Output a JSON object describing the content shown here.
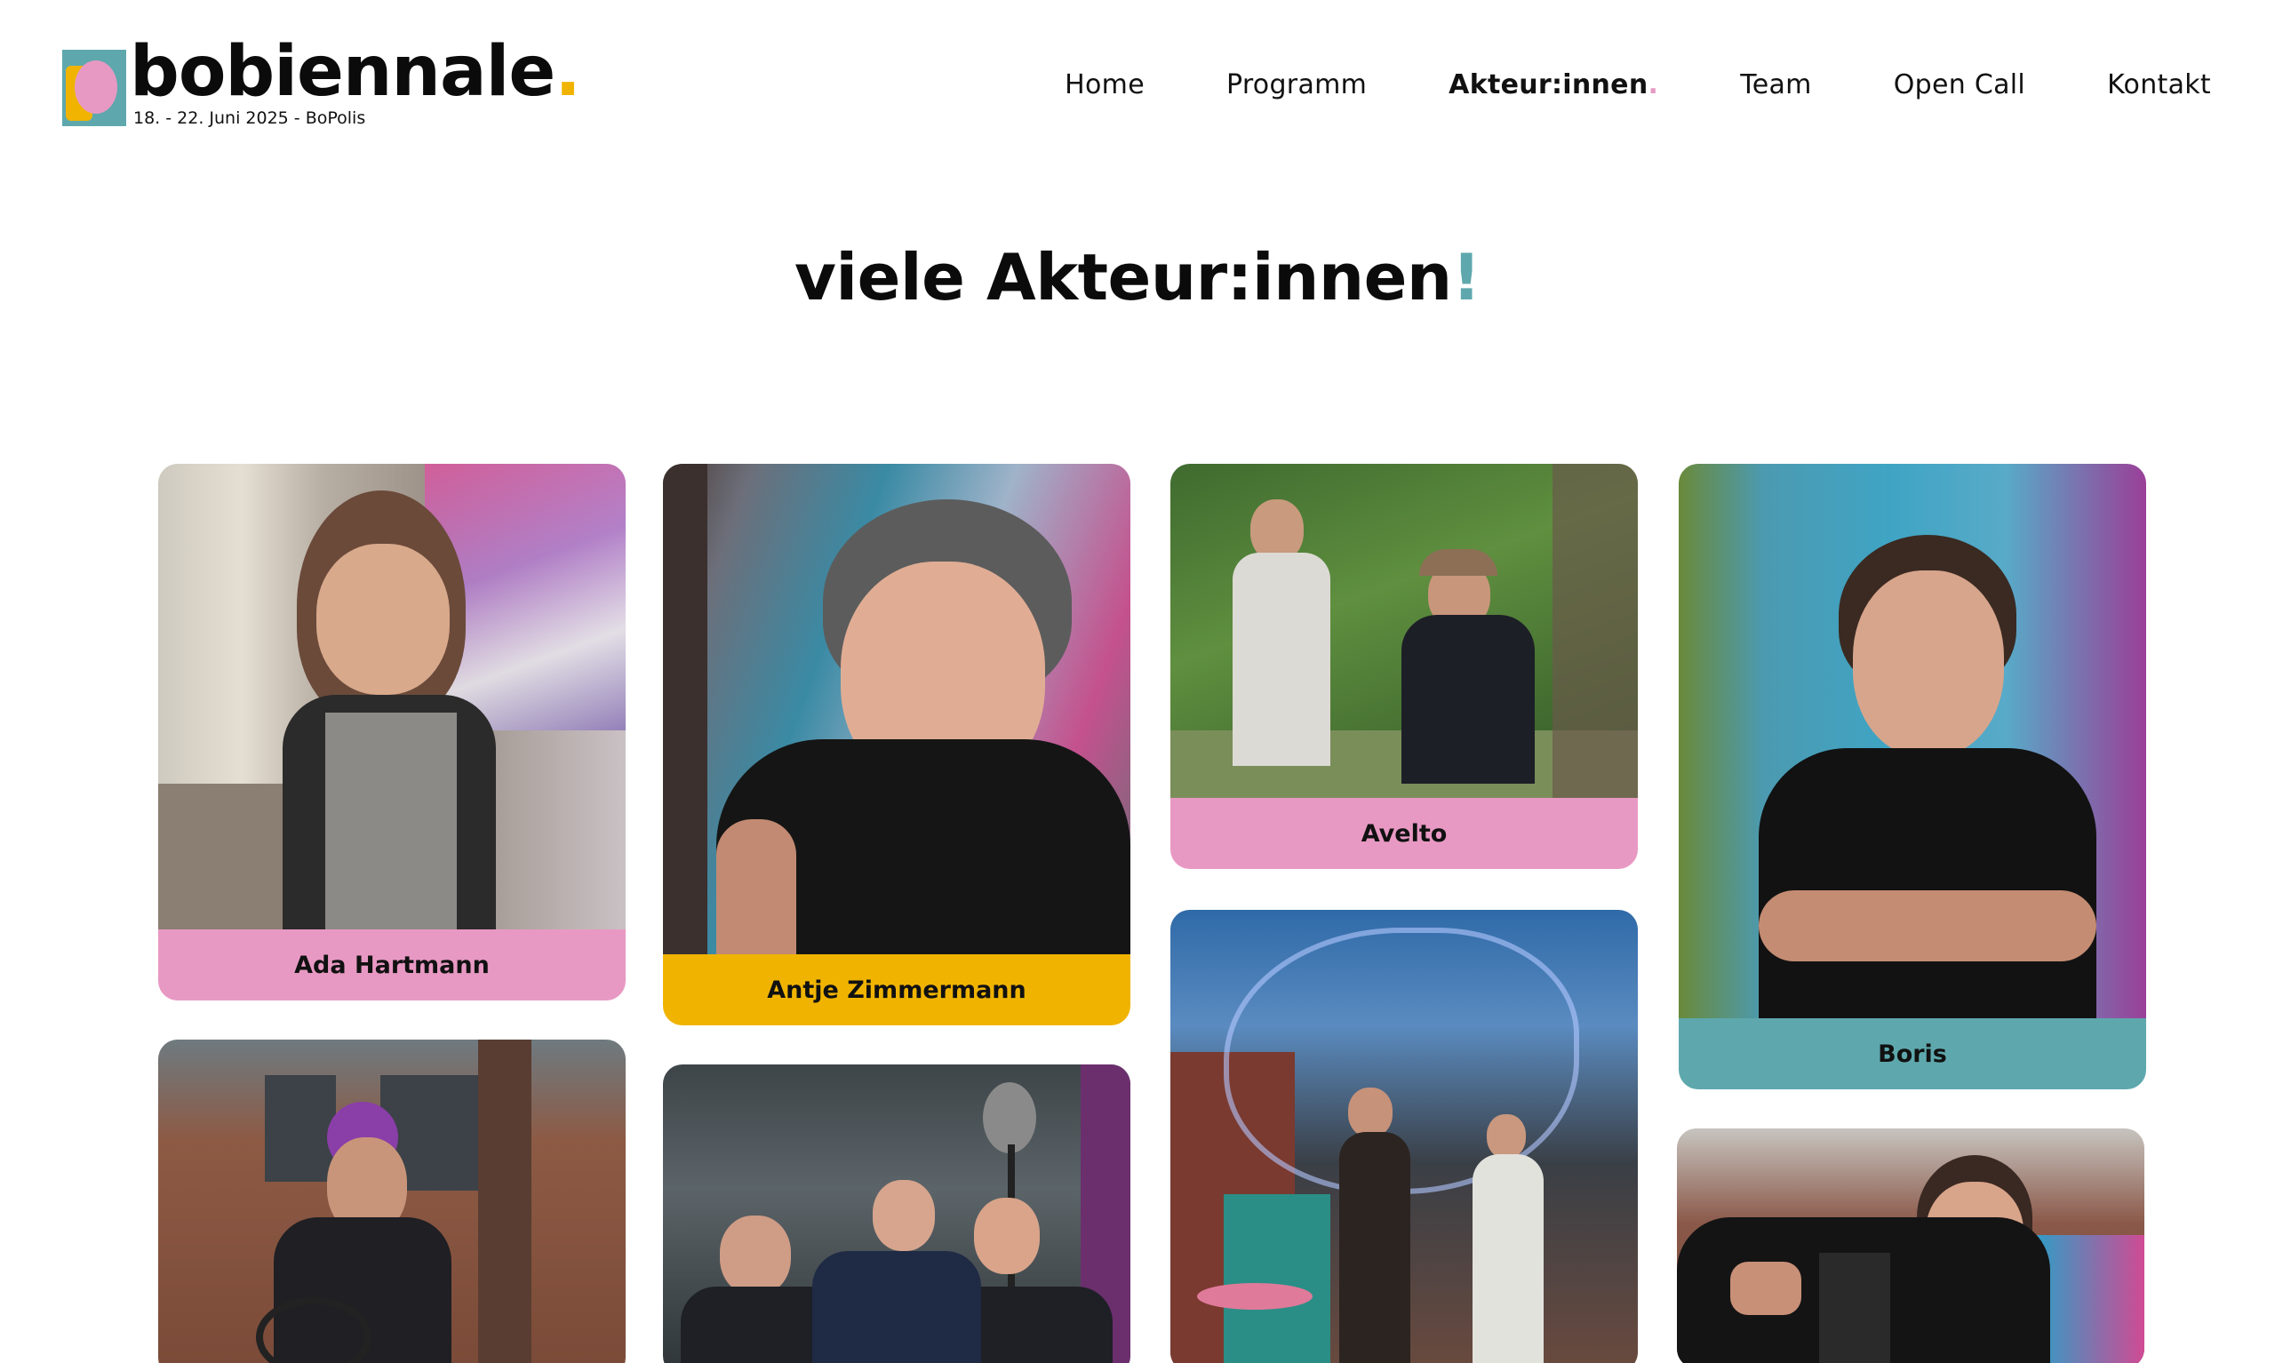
{
  "brand": {
    "name": "bobiennale",
    "dot": ".",
    "tagline": "18. - 22. Juni 2025 - BoPolis"
  },
  "nav": {
    "items": [
      {
        "label": "Home"
      },
      {
        "label": "Programm"
      },
      {
        "label": "Akteur:innen",
        "dot": "."
      },
      {
        "label": "Team"
      },
      {
        "label": "Open Call"
      },
      {
        "label": "Kontakt"
      }
    ]
  },
  "page": {
    "title": "viele Akteur:innen",
    "title_excl": "!"
  },
  "cards": [
    {
      "name": "Ada Hartmann",
      "color": "#e899c3"
    },
    {
      "name": "Antje Zimmermann",
      "color": "#f0b400"
    },
    {
      "name": "Avelto",
      "color": "#e899c3"
    },
    {
      "name": "Boris",
      "color": "#5ea8ad"
    }
  ],
  "colors": {
    "pink": "#e899c3",
    "yellow": "#f0b400",
    "teal": "#5ea8ad"
  }
}
